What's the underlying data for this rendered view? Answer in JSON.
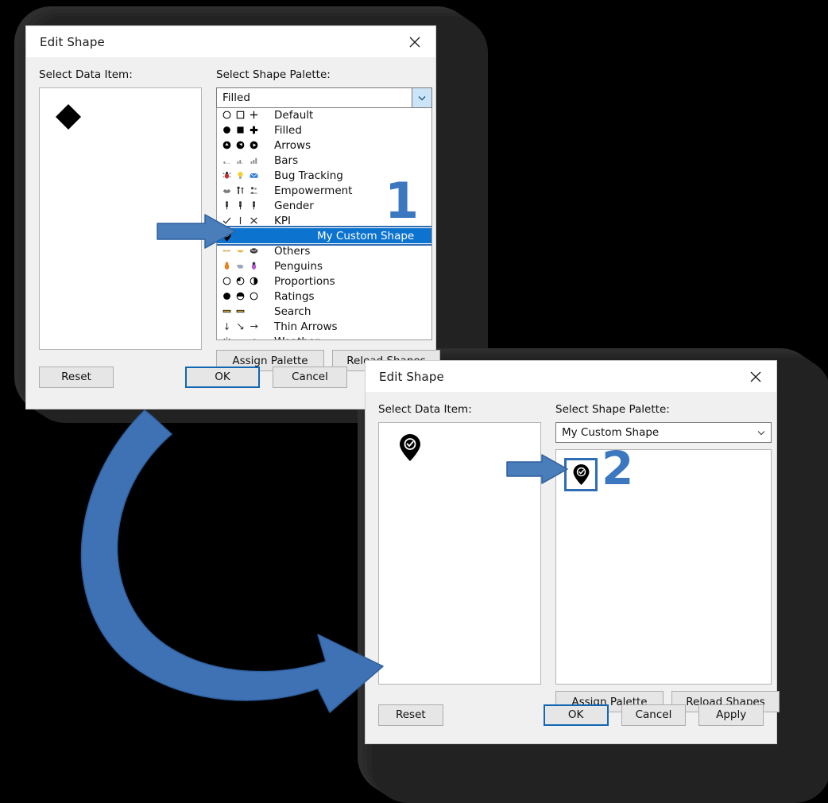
{
  "dialog1": {
    "title": "Edit Shape",
    "close_icon": "close-icon",
    "data_item_label": "Select Data Item:",
    "palette_label": "Select Shape Palette:",
    "combo_value": "Filled",
    "combo_arrow_icon": "chevron-down-icon",
    "data_item_shape": "filled-diamond-shape",
    "palette_items": [
      {
        "label": "Default",
        "icons": [
          "circle-outline-icon",
          "square-outline-icon",
          "plus-outline-icon"
        ]
      },
      {
        "label": "Filled",
        "icons": [
          "circle-filled-icon",
          "square-filled-icon",
          "plus-filled-icon"
        ]
      },
      {
        "label": "Arrows",
        "icons": [
          "arrow-up-circle-icon",
          "arrow-diag-circle-icon",
          "arrow-right-circle-icon"
        ]
      },
      {
        "label": "Bars",
        "icons": [
          "bars-low-icon",
          "bars-mid-icon",
          "bars-high-icon"
        ]
      },
      {
        "label": "Bug Tracking",
        "icons": [
          "bug-icon",
          "lightbulb-icon",
          "envelope-icon"
        ]
      },
      {
        "label": "Empowerment",
        "icons": [
          "handshake-icon",
          "people-icon",
          "group-icon"
        ]
      },
      {
        "label": "Gender",
        "icons": [
          "person-icon",
          "person-icon",
          "person-icon"
        ]
      },
      {
        "label": "KPI",
        "icons": [
          "check-icon",
          "bar-icon",
          "cross-icon"
        ]
      },
      {
        "label": "My Custom Shape",
        "icons": [
          "map-pin-check-icon"
        ],
        "selected": true
      },
      {
        "label": "Others",
        "icons": [
          "small-icon",
          "smile-icon",
          "blob-icon"
        ]
      },
      {
        "label": "Penguins",
        "icons": [
          "penguin-orange-icon",
          "penguin-grey-icon",
          "penguin-purple-icon"
        ]
      },
      {
        "label": "Proportions",
        "icons": [
          "circle-empty-icon",
          "circle-quarter-icon",
          "circle-half-icon"
        ]
      },
      {
        "label": "Ratings",
        "icons": [
          "circle-full-icon",
          "circle-threequarter-icon",
          "circle-outline-icon"
        ]
      },
      {
        "label": "Search",
        "icons": [
          "search-bar-icon",
          "search-bar-icon"
        ]
      },
      {
        "label": "Thin Arrows",
        "icons": [
          "arrow-down-thin-icon",
          "arrow-diag-thin-icon",
          "arrow-right-thin-icon"
        ]
      },
      {
        "label": "Weather",
        "icons": [
          "sun-icon",
          "cloud-icon",
          "rain-cloud-icon"
        ]
      }
    ],
    "assign_palette_label": "Assign Palette",
    "reload_shapes_label": "Reload Shapes",
    "reset_label": "Reset",
    "ok_label": "OK",
    "cancel_label": "Cancel"
  },
  "dialog2": {
    "title": "Edit Shape",
    "close_icon": "close-icon",
    "data_item_label": "Select Data Item:",
    "palette_label": "Select Shape Palette:",
    "combo_value": "My Custom Shape",
    "combo_arrow_icon": "chevron-down-icon",
    "data_item_shape": "map-pin-check-icon",
    "palette_shape": "map-pin-check-icon",
    "assign_palette_label": "Assign Palette",
    "reload_shapes_label": "Reload Shapes",
    "reset_label": "Reset",
    "ok_label": "OK",
    "cancel_label": "Cancel",
    "apply_label": "Apply"
  },
  "annotations": {
    "step_one": "1",
    "step_two": "2",
    "accent_color": "#3b78c0",
    "arrow_color": "#4a7ebb",
    "highlight_color": "#0c73cf"
  }
}
